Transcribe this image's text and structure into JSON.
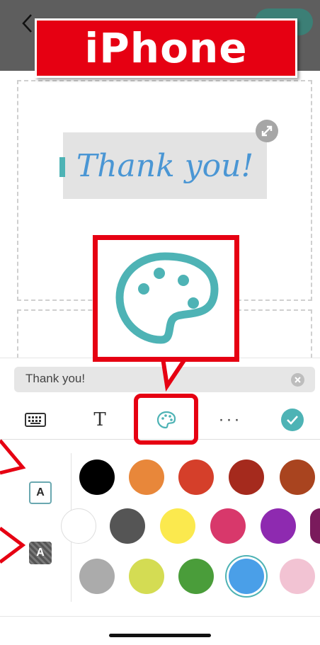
{
  "banner": {
    "label": "iPhone"
  },
  "canvas": {
    "text": "Thank you!"
  },
  "text_input": {
    "value": "Thank you!"
  },
  "toolbar": {
    "keyboard_icon": "keyboard-icon",
    "text_style_label": "T",
    "palette_icon": "palette-icon",
    "more_label": "···",
    "confirm_icon": "checkmark-icon"
  },
  "color_modes": [
    {
      "name": "text-color",
      "label": "A"
    },
    {
      "name": "background-color",
      "label": "A"
    }
  ],
  "colors": {
    "accent": "#4eb3b5",
    "highlight": "#e60012",
    "selected_swatch": "#4a9fe8"
  },
  "swatches": [
    [
      "#000000",
      "#e8873a",
      "#d53f2a",
      "#a52a1d",
      "#a9441f"
    ],
    [
      "#ffffff",
      "#555555",
      "#fbe94e",
      "#d8386b",
      "#8e2ab0",
      "#7a1a5c"
    ],
    [
      "#ababab",
      "#d4dc53",
      "#4a9d3a",
      "#4a9fe8",
      "#f2c3d3"
    ]
  ]
}
